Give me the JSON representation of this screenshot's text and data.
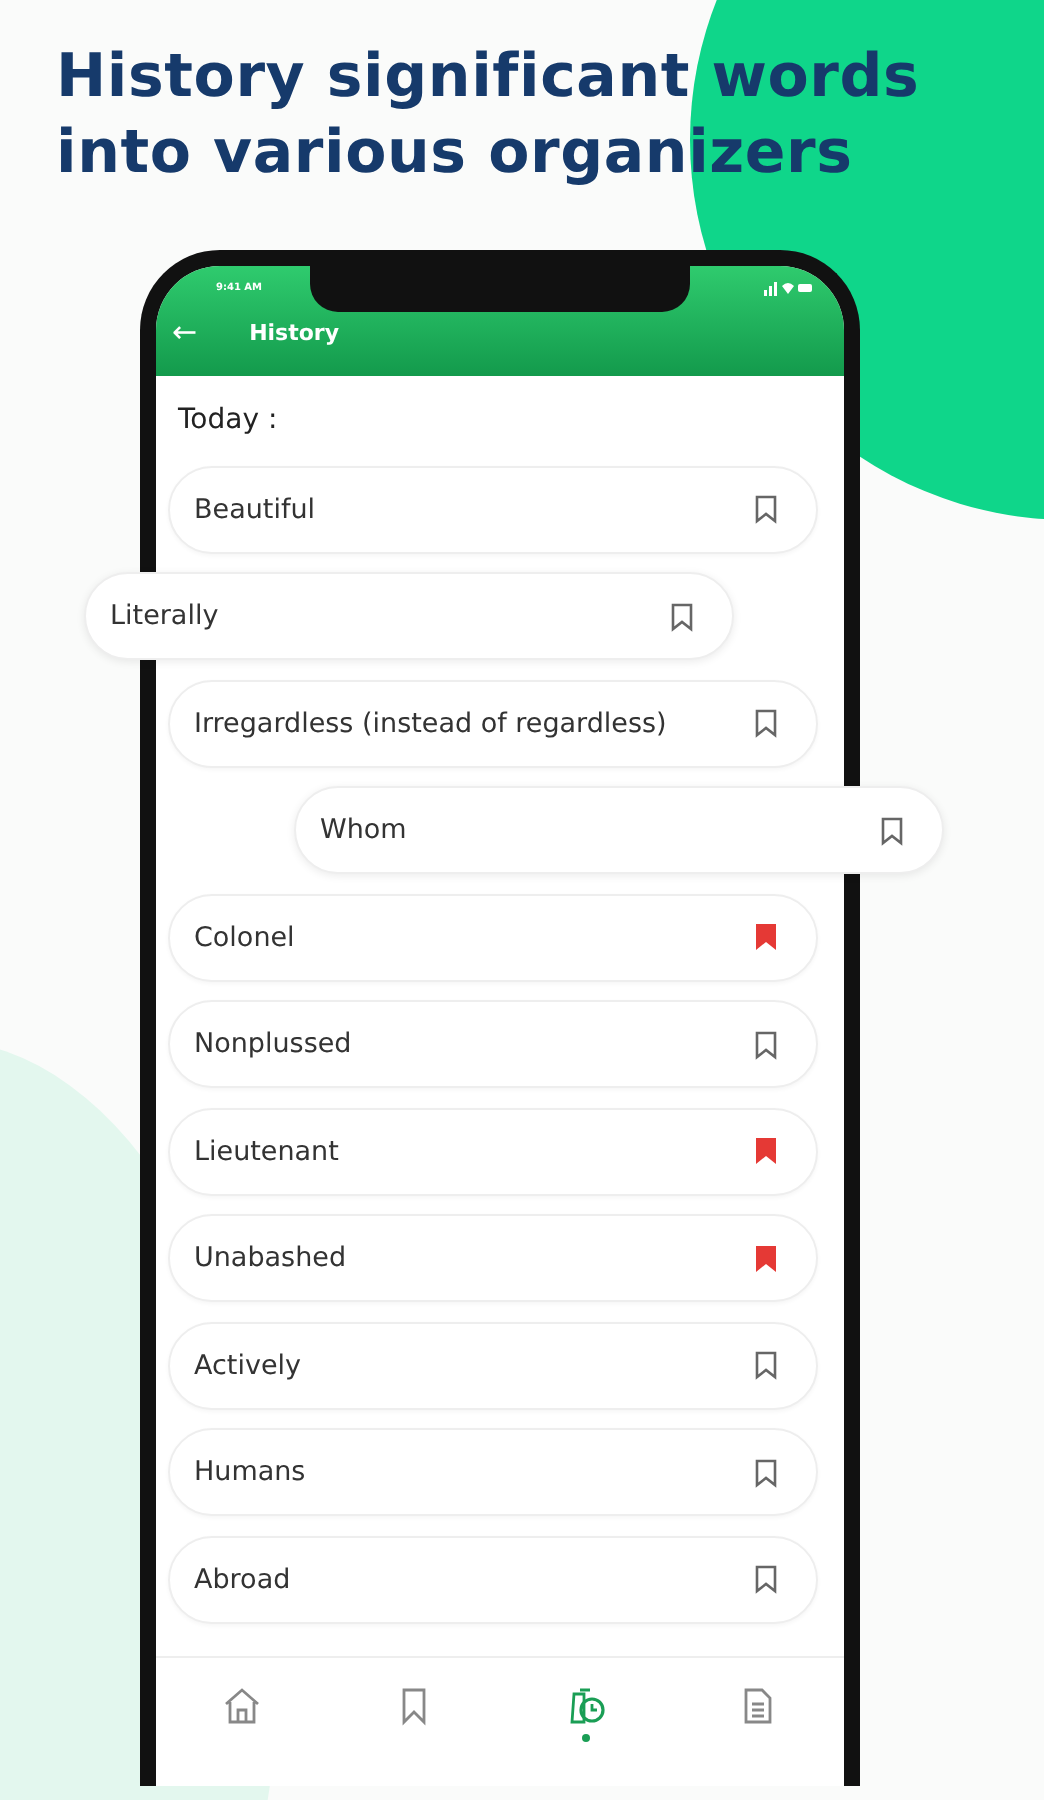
{
  "headline": "History significant words into various organizers",
  "status_bar": {
    "time": "9:41 AM"
  },
  "app_bar": {
    "back": "←",
    "title": "History"
  },
  "section": "Today :",
  "words": [
    {
      "text": "Beautiful",
      "bookmarked": false,
      "kind": "row"
    },
    {
      "text": "Literally",
      "bookmarked": false,
      "kind": "shifted-left"
    },
    {
      "text": "Irregardless (instead of regardless)",
      "bookmarked": false,
      "kind": "row"
    },
    {
      "text": "Whom",
      "bookmarked": false,
      "kind": "shifted-right"
    },
    {
      "text": "Colonel",
      "bookmarked": true,
      "kind": "row"
    },
    {
      "text": "Nonplussed",
      "bookmarked": false,
      "kind": "row"
    },
    {
      "text": "Lieutenant",
      "bookmarked": true,
      "kind": "row"
    },
    {
      "text": "Unabashed",
      "bookmarked": true,
      "kind": "row"
    },
    {
      "text": "Actively",
      "bookmarked": false,
      "kind": "row"
    },
    {
      "text": "Humans",
      "bookmarked": false,
      "kind": "row"
    },
    {
      "text": "Abroad",
      "bookmarked": false,
      "kind": "row"
    }
  ],
  "bottom_nav": [
    {
      "kind": "home",
      "selected": false
    },
    {
      "kind": "bookmarks",
      "selected": false
    },
    {
      "kind": "history",
      "selected": true
    },
    {
      "kind": "notes",
      "selected": false
    }
  ]
}
